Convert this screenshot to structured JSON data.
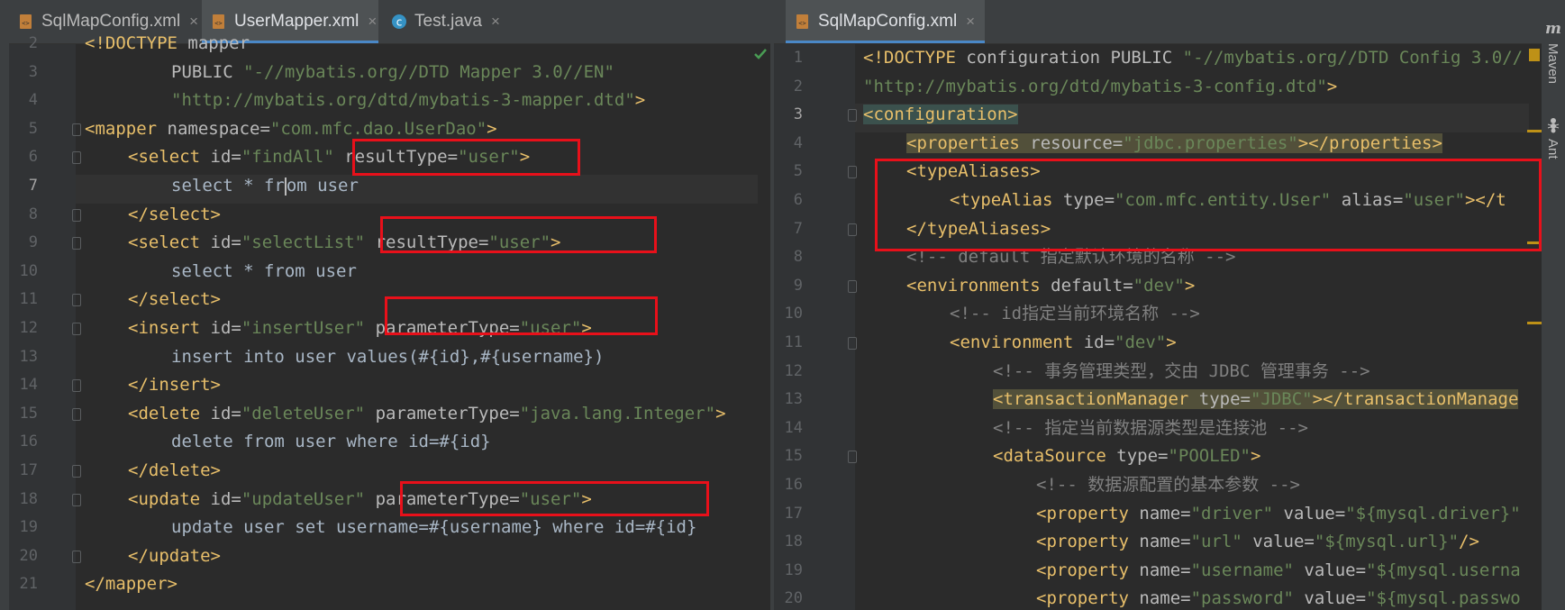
{
  "left_tabs": [
    {
      "label": "SqlMapConfig.xml",
      "icon": "xml-file-icon",
      "active": false
    },
    {
      "label": "UserMapper.xml",
      "icon": "xml-file-icon",
      "active": true
    },
    {
      "label": "Test.java",
      "icon": "java-class-icon",
      "active": false
    }
  ],
  "right_tabs": [
    {
      "label": "SqlMapConfig.xml",
      "icon": "xml-file-icon",
      "active": true
    }
  ],
  "close_glyph": "×",
  "left_editor": {
    "line_numbers": [
      "2",
      "3",
      "4",
      "5",
      "6",
      "7",
      "8",
      "9",
      "10",
      "11",
      "12",
      "13",
      "14",
      "15",
      "16",
      "17",
      "18",
      "19",
      "20",
      "21"
    ],
    "current_line": "7",
    "lines": [
      "<!DOCTYPE mapper",
      "PUBLIC \"-//mybatis.org//DTD Mapper 3.0//EN\"",
      "\"http://mybatis.org/dtd/mybatis-3-mapper.dtd\">",
      "<mapper namespace=\"com.mfc.dao.UserDao\">",
      "<select id=\"findAll\" resultType=\"user\">",
      "select * from user",
      "</select>",
      "<select id=\"selectList\" resultType=\"user\">",
      "select * from user",
      "</select>",
      "<insert id=\"insertUser\" parameterType=\"user\">",
      "insert into user values(#{id},#{username})",
      "</insert>",
      "<delete id=\"deleteUser\" parameterType=\"java.lang.Integer\">",
      "delete from user where id=#{id}",
      "</delete>",
      "<update id=\"updateUser\" parameterType=\"user\">",
      "update user set username=#{username} where id=#{id}",
      "</update>",
      "</mapper>"
    ]
  },
  "right_editor": {
    "line_numbers": [
      "1",
      "2",
      "3",
      "4",
      "5",
      "6",
      "7",
      "8",
      "9",
      "10",
      "11",
      "12",
      "13",
      "14",
      "15",
      "16",
      "17",
      "18",
      "19",
      "20"
    ],
    "current_line": "3",
    "lines": [
      "<!DOCTYPE configuration PUBLIC \"-//mybatis.org//DTD Config 3.0//",
      "\"http://mybatis.org/dtd/mybatis-3-config.dtd\">",
      "<configuration>",
      "<properties resource=\"jdbc.properties\"></properties>",
      "<typeAliases>",
      "<typeAlias type=\"com.mfc.entity.User\" alias=\"user\"></t",
      "</typeAliases>",
      "<!-- default 指定默认环境的名称 -->",
      "<environments default=\"dev\">",
      "<!-- id指定当前环境名称 -->",
      "<environment id=\"dev\">",
      "<!-- 事务管理类型，交由 JDBC 管理事务 -->",
      "<transactionManager type=\"JDBC\"></transactionManage",
      "<!-- 指定当前数据源类型是连接池 -->",
      "<dataSource type=\"POOLED\">",
      "<!-- 数据源配置的基本参数 -->",
      "<property name=\"driver\" value=\"${mysql.driver}\"",
      "<property name=\"url\" value=\"${mysql.url}\"/>",
      "<property name=\"username\" value=\"${mysql.userna",
      "<property name=\"password\" value=\"${mysql.passwo"
    ]
  },
  "tool_windows": [
    "Maven",
    "Ant"
  ],
  "colors": {
    "tag": "#e8bf6a",
    "attribute": "#bababa",
    "string": "#6a8759",
    "comment": "#808080",
    "annotation_box": "#e8101a",
    "active_tab_underline": "#4a88c7"
  }
}
